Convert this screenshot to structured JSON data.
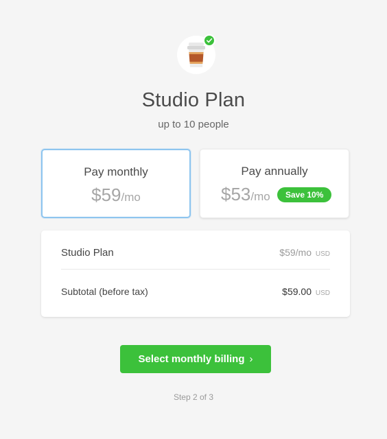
{
  "header": {
    "icon": "coffee-cup-icon",
    "badge_icon": "check-icon",
    "title": "Studio Plan",
    "subtitle": "up to 10 people"
  },
  "options": {
    "monthly": {
      "label": "Pay monthly",
      "price": "$59",
      "period": "/mo",
      "selected": true
    },
    "annual": {
      "label": "Pay annually",
      "price": "$53",
      "period": "/mo",
      "badge": "Save 10%",
      "selected": false
    }
  },
  "summary": {
    "line_item": {
      "label": "Studio Plan",
      "amount": "$59/mo",
      "currency": "USD"
    },
    "subtotal": {
      "label": "Subtotal (before tax)",
      "amount": "$59.00",
      "currency": "USD"
    }
  },
  "cta": {
    "label": "Select monthly billing",
    "icon": "chevron-right-icon"
  },
  "footer": {
    "step": "Step 2 of 3"
  },
  "colors": {
    "accent_green": "#3cc13b",
    "selected_border": "#8ec5ef",
    "background": "#f5f5f5"
  }
}
